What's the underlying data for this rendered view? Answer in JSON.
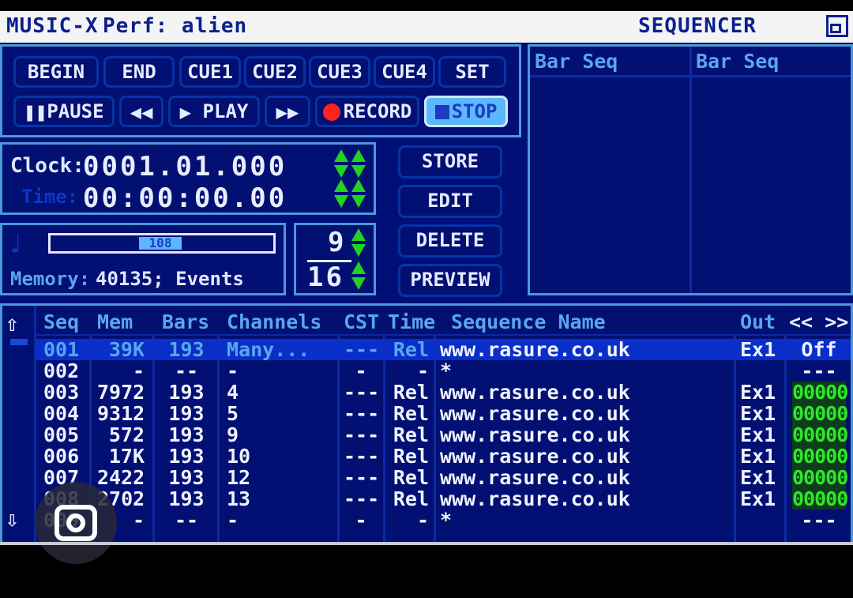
{
  "titlebar": {
    "app": "MUSIC-X",
    "perf": "Perf: alien",
    "mode": "SEQUENCER"
  },
  "transport": {
    "begin": "BEGIN",
    "end": "END",
    "cue1": "CUE1",
    "cue2": "CUE2",
    "cue3": "CUE3",
    "cue4": "CUE4",
    "set": "SET",
    "pause": "PAUSE",
    "play": "PLAY",
    "record": "RECORD",
    "stop": "STOP"
  },
  "clock": {
    "clock_label": "Clock:",
    "clock_value": "0001.01.000",
    "time_label": "Time:",
    "time_value": "00:00:00.00"
  },
  "tempo": {
    "value": "108",
    "value_fraction": 0.49,
    "memory_label": "Memory:",
    "memory_value": "40135; Events"
  },
  "time_signature": {
    "numerator": "9",
    "denominator": "16"
  },
  "actions": {
    "store": "STORE",
    "edit": "EDIT",
    "delete": "DELETE",
    "preview": "PREVIEW"
  },
  "barseq": {
    "col1": "Bar Seq",
    "col2": "Bar Seq"
  },
  "table": {
    "headers": {
      "seq": "Seq",
      "mem": "Mem",
      "bars": "Bars",
      "channels": "Channels",
      "cst": "CST",
      "time": "Time",
      "name": "Sequence Name",
      "out": "Out",
      "nav": "<< >>"
    },
    "rows": [
      {
        "seq": "001",
        "mem": "39K",
        "bars": "193",
        "channels": "Many...",
        "cst": "---",
        "time": "Rel",
        "name": "www.rasure.co.uk",
        "out": "Ex1",
        "last": "Off",
        "selected": true
      },
      {
        "seq": "002",
        "mem": "-",
        "bars": "--",
        "channels": "-",
        "cst": "-",
        "time": "-",
        "name": "*",
        "out": "",
        "last": "---",
        "selected": false
      },
      {
        "seq": "003",
        "mem": "7972",
        "bars": "193",
        "channels": "4",
        "cst": "---",
        "time": "Rel",
        "name": "www.rasure.co.uk",
        "out": "Ex1",
        "last": "00000",
        "selected": false
      },
      {
        "seq": "004",
        "mem": "9312",
        "bars": "193",
        "channels": "5",
        "cst": "---",
        "time": "Rel",
        "name": "www.rasure.co.uk",
        "out": "Ex1",
        "last": "00000",
        "selected": false
      },
      {
        "seq": "005",
        "mem": "572",
        "bars": "193",
        "channels": "9",
        "cst": "---",
        "time": "Rel",
        "name": "www.rasure.co.uk",
        "out": "Ex1",
        "last": "00000",
        "selected": false
      },
      {
        "seq": "006",
        "mem": "17K",
        "bars": "193",
        "channels": "10",
        "cst": "---",
        "time": "Rel",
        "name": "www.rasure.co.uk",
        "out": "Ex1",
        "last": "00000",
        "selected": false
      },
      {
        "seq": "007",
        "mem": "2422",
        "bars": "193",
        "channels": "12",
        "cst": "---",
        "time": "Rel",
        "name": "www.rasure.co.uk",
        "out": "Ex1",
        "last": "00000",
        "selected": false
      },
      {
        "seq": "008",
        "mem": "2702",
        "bars": "193",
        "channels": "13",
        "cst": "---",
        "time": "Rel",
        "name": "www.rasure.co.uk",
        "out": "Ex1",
        "last": "00000",
        "selected": false
      },
      {
        "seq": "009",
        "mem": "-",
        "bars": "--",
        "channels": "-",
        "cst": "-",
        "time": "-",
        "name": "*",
        "out": "",
        "last": "---",
        "selected": false
      }
    ]
  },
  "colors": {
    "background": "#000f78",
    "accent_green": "#2ee82a",
    "record_red": "#ff2222",
    "stop_active": "#5db7ff"
  }
}
